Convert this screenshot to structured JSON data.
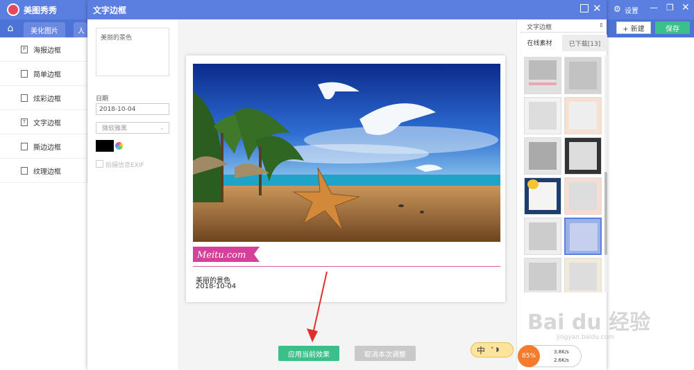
{
  "app": {
    "title": "美图秀秀",
    "tabs": [
      "美化图片",
      "人"
    ],
    "settings_label": "设置",
    "new_label": "+ 新建",
    "save_label": "保存"
  },
  "sidebar": {
    "items": [
      {
        "label": "海报边框",
        "icon": "P"
      },
      {
        "label": "简单边框",
        "icon": ""
      },
      {
        "label": "炫彩边框",
        "icon": ""
      },
      {
        "label": "文字边框",
        "icon": "T"
      },
      {
        "label": "撕边边框",
        "icon": ""
      },
      {
        "label": "纹理边框",
        "icon": ""
      }
    ]
  },
  "modal": {
    "title": "文字边框",
    "text_value": "美丽的景色",
    "date_label": "日期",
    "date_value": "2018-10-04",
    "font_value": "微软雅黑",
    "exif_label": "拍摄信息EXIF",
    "text_color": "#000000",
    "apply_label": "应用当前效果",
    "cancel_label": "取消本次调整"
  },
  "preview": {
    "banner_text": "Meitu.com",
    "caption_text": "美丽的景色",
    "caption_date": "2018-10-04"
  },
  "materials": {
    "category": "文字边框",
    "tab_online": "在线素材",
    "tab_downloaded": "已下载[13]"
  },
  "ime": {
    "label": "中"
  },
  "net": {
    "percent": "85%",
    "up": "3.8K/s",
    "down": "2.6K/s"
  },
  "watermark": {
    "text": "Bai du 经验",
    "sub": "jingyan.baidu.com"
  },
  "colors": {
    "accent": "#5b7fe0",
    "green": "#3cbf89",
    "pink": "#d6409a"
  }
}
